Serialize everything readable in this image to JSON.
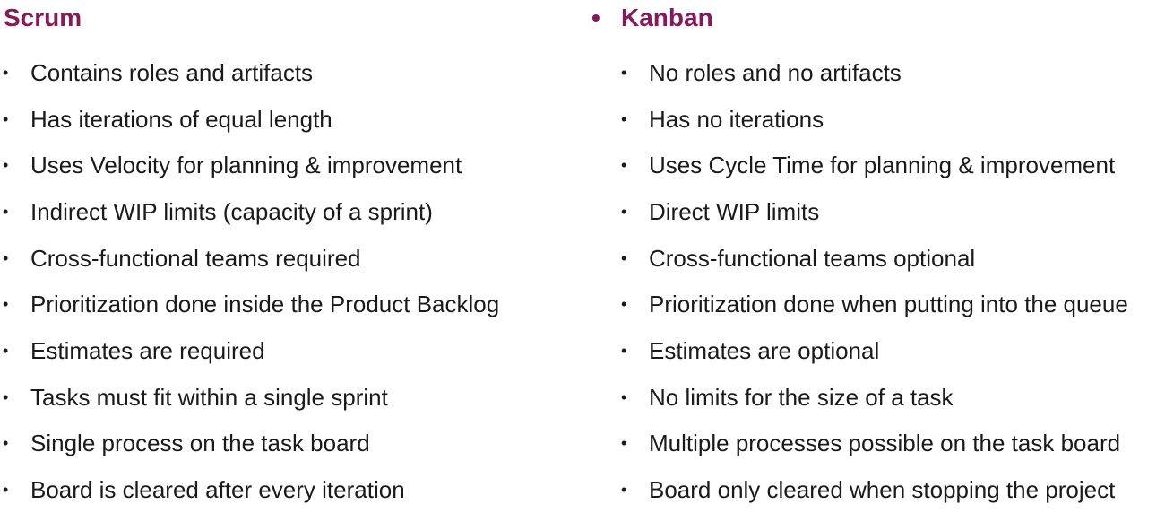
{
  "colors": {
    "heading": "#85195c",
    "text": "#1a1a1a",
    "background": "#ffffff"
  },
  "scrum": {
    "title": "Scrum",
    "items": [
      "Contains roles and artifacts",
      "Has iterations of equal length",
      "Uses Velocity for planning & improvement",
      "Indirect WIP limits (capacity of a sprint)",
      "Cross-functional teams required",
      "Prioritization done inside the Product Backlog",
      "Estimates are required",
      "Tasks must fit within a single sprint",
      "Single process on the task board",
      "Board is cleared after every iteration"
    ]
  },
  "kanban": {
    "bullet": "•",
    "title": "Kanban",
    "items": [
      "No roles and no artifacts",
      "Has no iterations",
      "Uses Cycle Time for planning & improvement",
      "Direct WIP limits",
      "Cross-functional teams optional",
      "Prioritization done when putting into the queue",
      "Estimates are optional",
      "No limits for the size of a task",
      "Multiple processes possible on the task board",
      "Board only cleared when stopping the project"
    ]
  },
  "item_bullet": "•"
}
